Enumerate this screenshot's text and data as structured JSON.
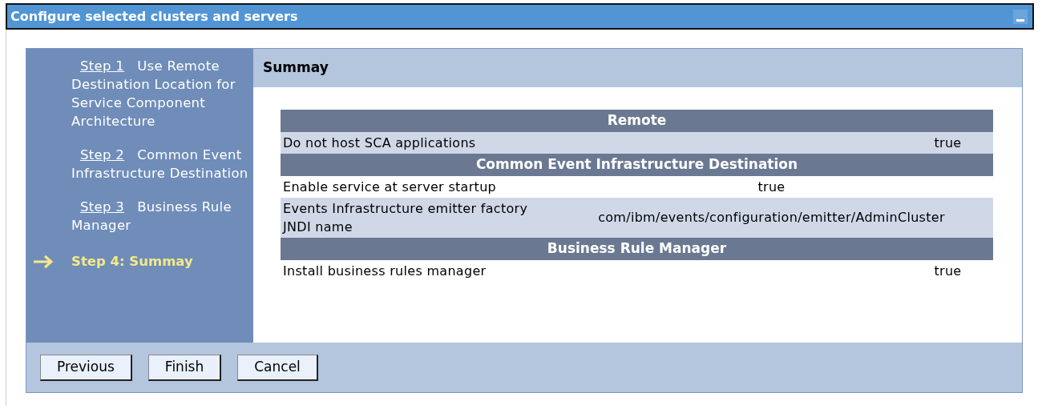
{
  "window": {
    "title": "Configure selected clusters and servers"
  },
  "steps": [
    {
      "link": "Step 1",
      "label": "Use Remote Destination Location for Service Component Architecture",
      "selected": false
    },
    {
      "link": "Step 2",
      "label": "Common Event Infrastructure Destination",
      "selected": false
    },
    {
      "link": "Step 3",
      "label": "Business Rule Manager",
      "selected": false
    },
    {
      "label": "Step 4: Summay",
      "selected": true
    }
  ],
  "content": {
    "heading": "Summay",
    "sections": [
      {
        "title": "Remote",
        "rows": [
          {
            "label": "Do not host SCA applications",
            "value": "true"
          }
        ]
      },
      {
        "title": "Common Event Infrastructure Destination",
        "rows": [
          {
            "label": "Enable service at server startup",
            "value": "true"
          },
          {
            "label": "Events Infrastructure emitter factory JNDI name",
            "value": "com/ibm/events/configuration/emitter/AdminCluster"
          }
        ]
      },
      {
        "title": "Business Rule Manager",
        "rows": [
          {
            "label": "Install business rules manager",
            "value": "true"
          }
        ]
      }
    ]
  },
  "buttons": [
    "Previous",
    "Finish",
    "Cancel"
  ]
}
